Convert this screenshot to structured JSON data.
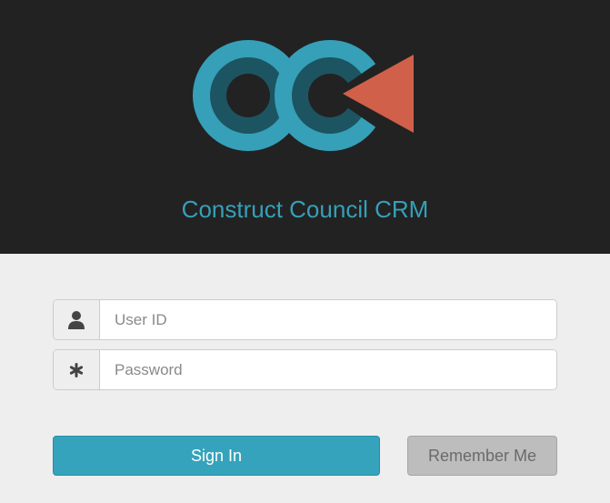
{
  "app": {
    "title": "Construct Council CRM"
  },
  "login": {
    "user_id_placeholder": "User ID",
    "password_placeholder": "Password",
    "sign_in_label": "Sign In",
    "remember_me_label": "Remember Me"
  },
  "icons": {
    "user_field": "user-icon",
    "password_field": "asterisk-icon"
  },
  "colors": {
    "header_bg": "#222222",
    "accent": "#35a3bb",
    "logo_teal": "#35a0b8",
    "logo_dark_teal": "#1d5462",
    "logo_triangle": "#d0604a",
    "remember_bg": "#bdbdbd"
  }
}
